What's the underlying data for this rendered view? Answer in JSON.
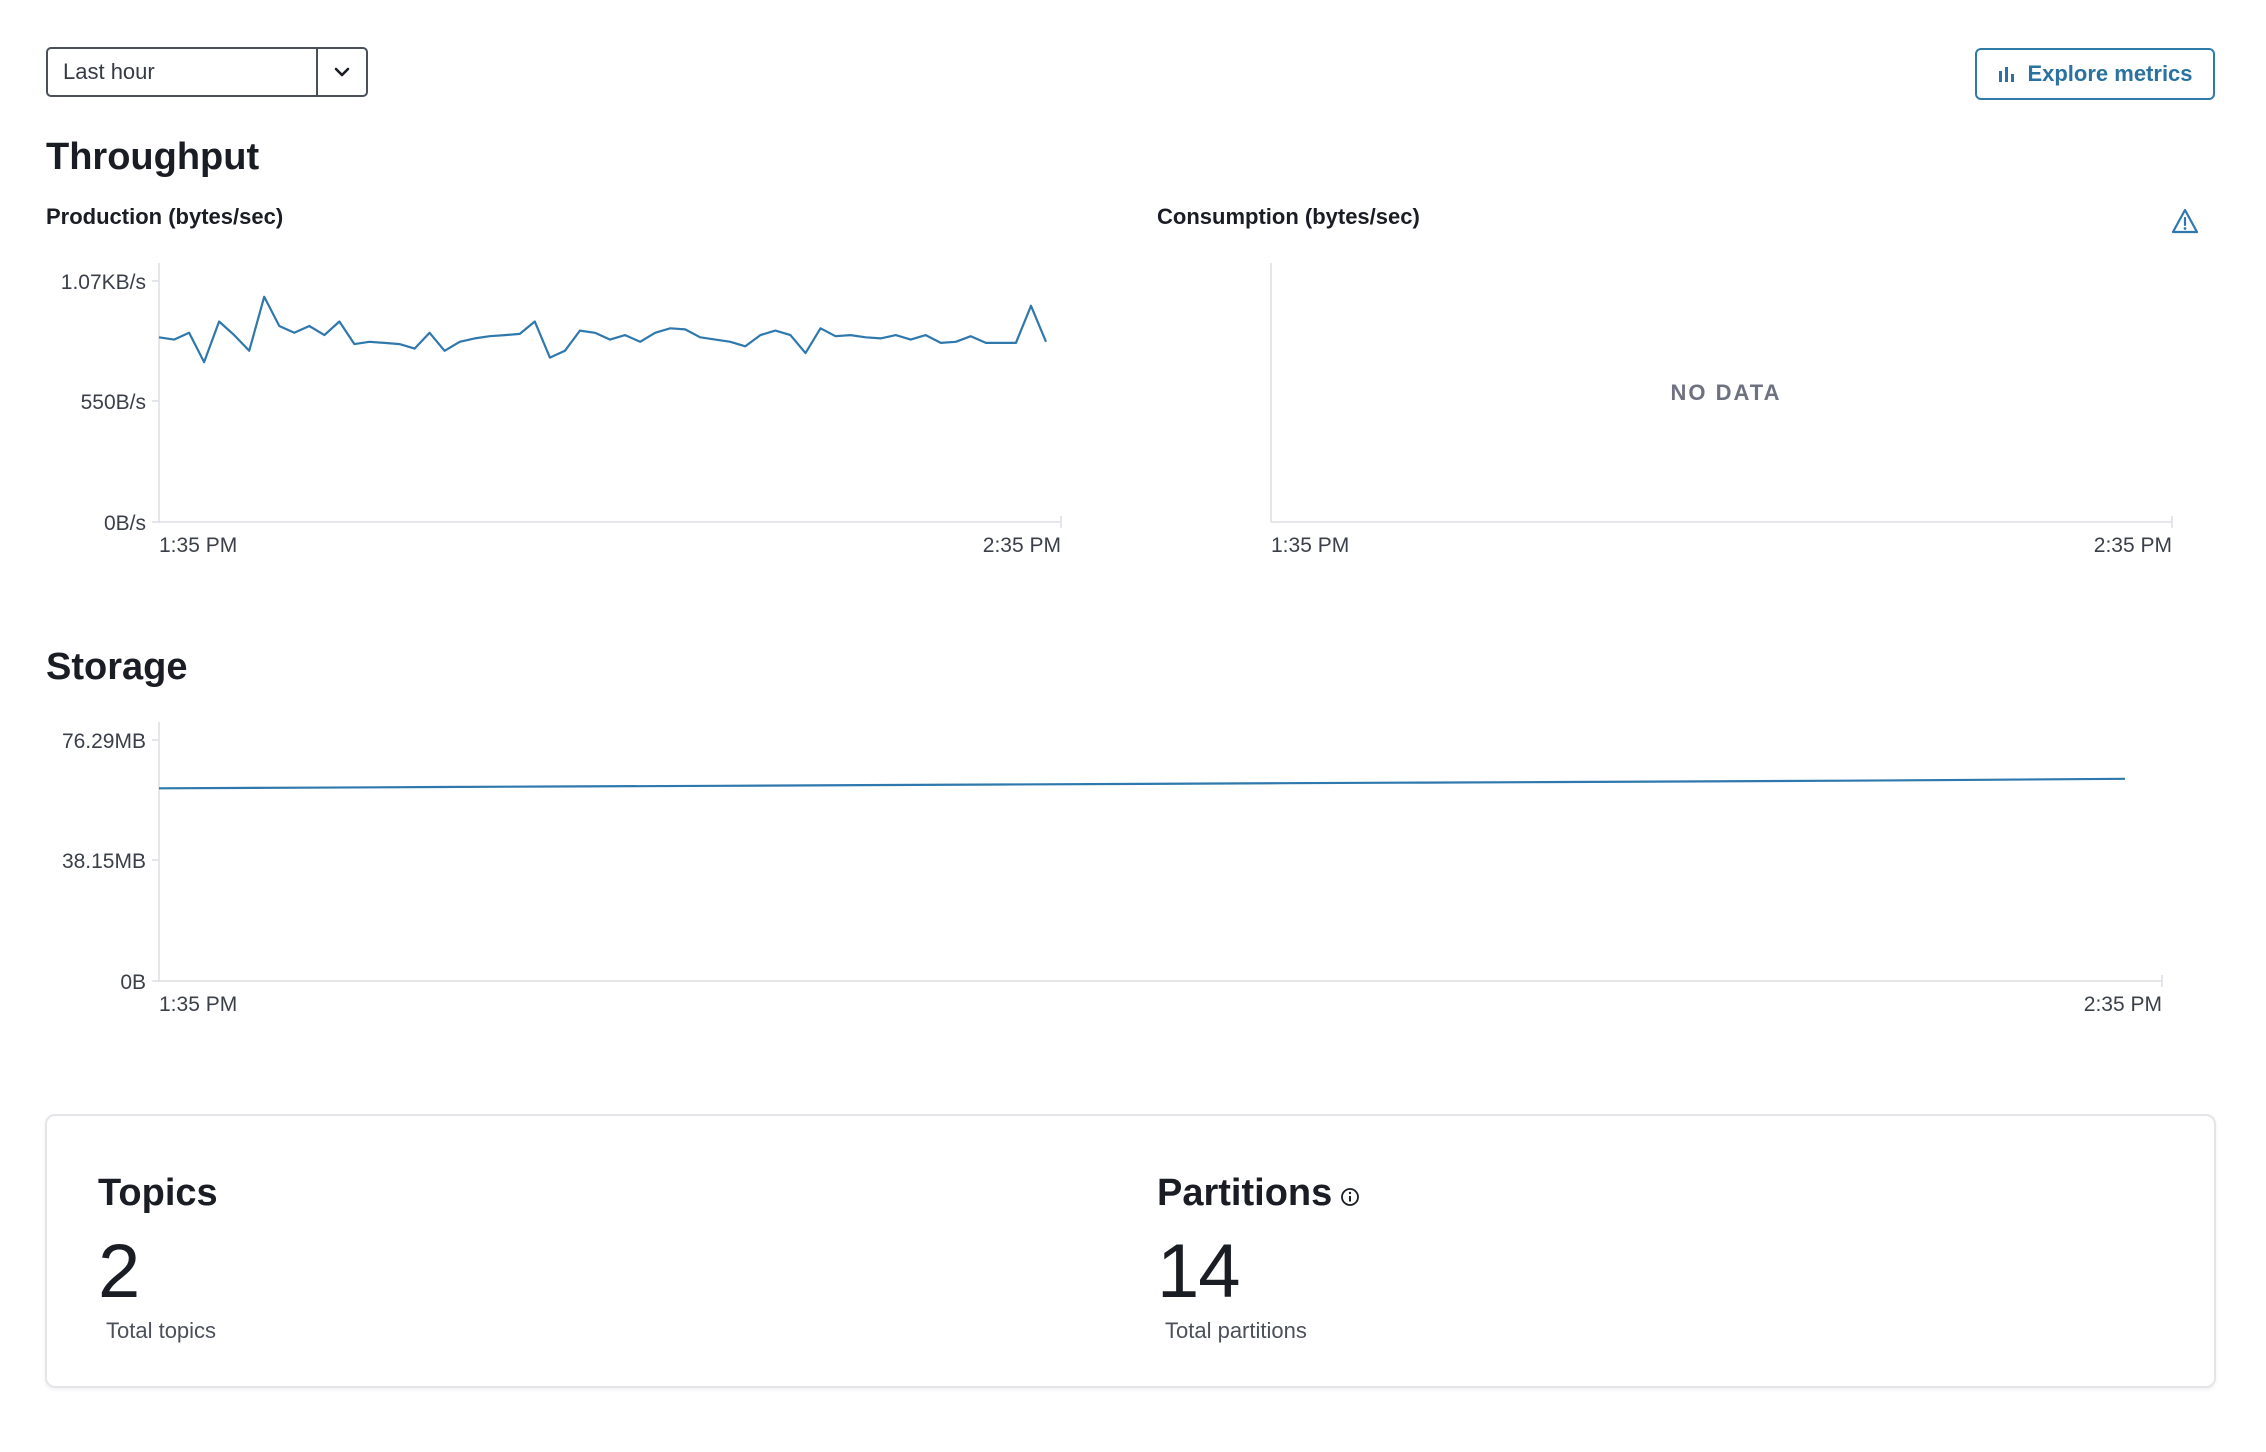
{
  "toolbar": {
    "time_range": "Last hour",
    "explore_label": "Explore metrics"
  },
  "throughput": {
    "title": "Throughput",
    "production": {
      "title": "Production (bytes/sec)",
      "y_ticks": [
        "1.07KB/s",
        "550B/s",
        "0B/s"
      ],
      "x_ticks": [
        "1:35 PM",
        "2:35 PM"
      ]
    },
    "consumption": {
      "title": "Consumption (bytes/sec)",
      "no_data": "NO DATA",
      "x_ticks": [
        "1:35 PM",
        "2:35 PM"
      ],
      "warning_icon": "warning-icon"
    }
  },
  "storage": {
    "title": "Storage",
    "y_ticks": [
      "76.29MB",
      "38.15MB",
      "0B"
    ],
    "x_ticks": [
      "1:35 PM",
      "2:35 PM"
    ]
  },
  "stats": {
    "topics": {
      "label": "Topics",
      "value": "2",
      "caption": "Total topics"
    },
    "partitions": {
      "label": "Partitions",
      "value": "14",
      "caption": "Total partitions",
      "icon": "info-icon"
    }
  },
  "colors": {
    "accent": "#2f78ad",
    "text": "#1a1d24"
  },
  "chart_data": [
    {
      "type": "line",
      "title": "Production (bytes/sec)",
      "ylabel": "bytes/sec",
      "y_unit": "B/s",
      "ylim": [
        0,
        1070
      ],
      "x_range": [
        "1:35 PM",
        "2:35 PM"
      ],
      "grid": false,
      "series": [
        {
          "values": [
            820,
            810,
            840,
            710,
            890,
            830,
            760,
            1000,
            870,
            840,
            870,
            830,
            890,
            790,
            800,
            795,
            790,
            770,
            840,
            760,
            800,
            815,
            825,
            830,
            835,
            890,
            730,
            760,
            850,
            840,
            810,
            830,
            800,
            840,
            860,
            855,
            820,
            810,
            800,
            780,
            830,
            850,
            830,
            750,
            860,
            825,
            830,
            820,
            815,
            830,
            810,
            830,
            795,
            800,
            825,
            795,
            795,
            795,
            960,
            800
          ]
        }
      ]
    },
    {
      "type": "line",
      "title": "Consumption (bytes/sec)",
      "x_range": [
        "1:35 PM",
        "2:35 PM"
      ],
      "series": []
    },
    {
      "type": "line",
      "title": "Storage",
      "y_unit": "MB",
      "ylim": [
        0,
        76.29
      ],
      "x_range": [
        "1:35 PM",
        "2:35 PM"
      ],
      "grid": false,
      "series": [
        {
          "values": [
            61.0,
            61.2,
            61.4,
            61.6,
            61.8,
            62.0,
            62.2,
            62.4,
            62.6,
            62.8,
            63.0,
            63.2,
            63.4,
            63.7,
            64.0
          ]
        }
      ]
    }
  ]
}
